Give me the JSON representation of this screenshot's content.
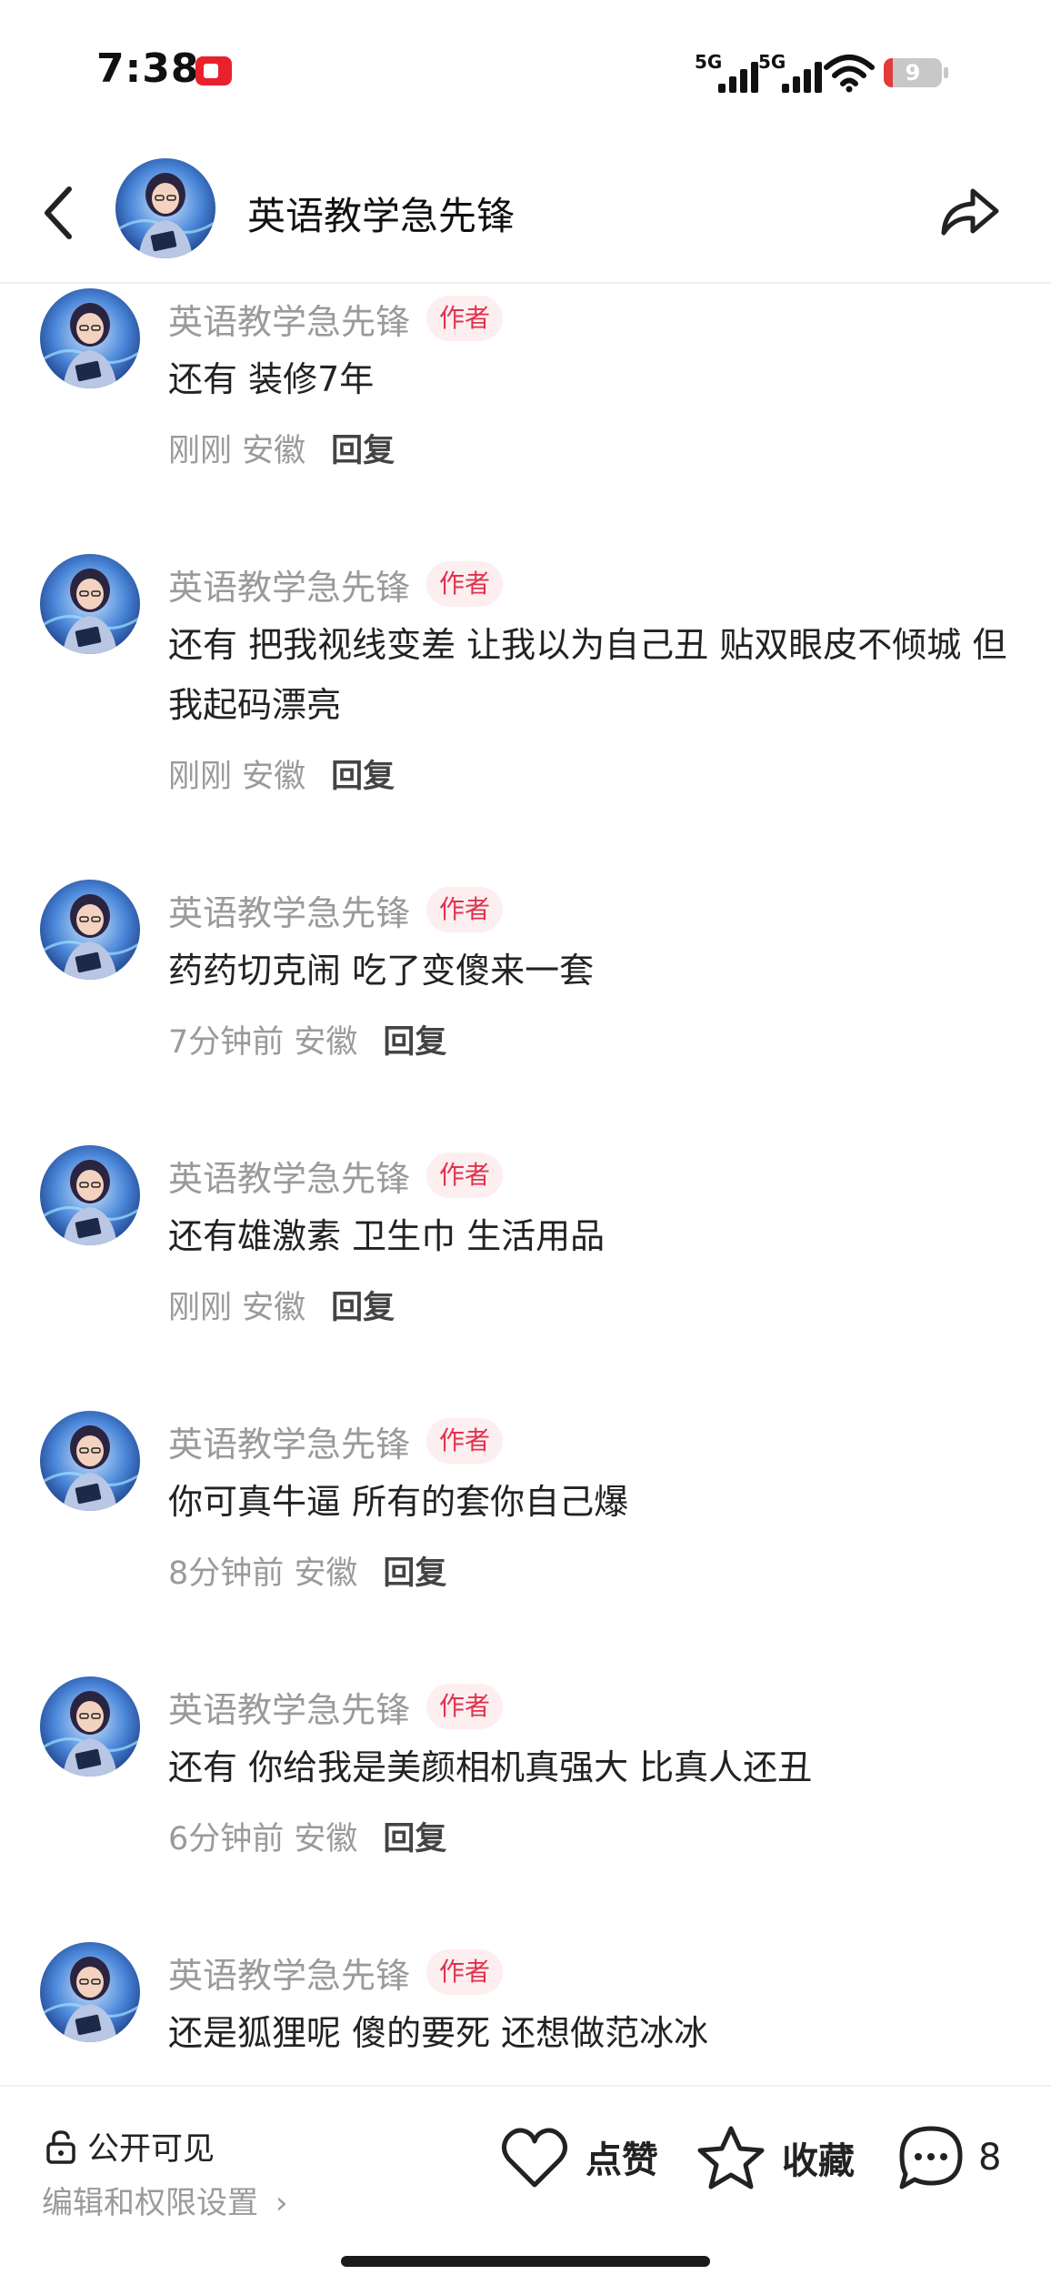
{
  "status_bar": {
    "time": "7:38",
    "net1": "5G",
    "net2": "5G",
    "battery_level": "9",
    "battery_fraction": 0.09
  },
  "header": {
    "title": "英语教学急先锋"
  },
  "comments": [
    {
      "name": "英语教学急先锋",
      "badge": "作者",
      "text": "还有 装修7年",
      "time": "刚刚 安徽",
      "reply": "回复"
    },
    {
      "name": "英语教学急先锋",
      "badge": "作者",
      "text": "还有 把我视线变差 让我以为自己丑 贴双眼皮不倾城 但我起码漂亮",
      "time": "刚刚 安徽",
      "reply": "回复"
    },
    {
      "name": "英语教学急先锋",
      "badge": "作者",
      "text": "药药切克闹 吃了变傻来一套",
      "time": "7分钟前 安徽",
      "reply": "回复"
    },
    {
      "name": "英语教学急先锋",
      "badge": "作者",
      "text": "还有雄激素 卫生巾 生活用品",
      "time": "刚刚 安徽",
      "reply": "回复"
    },
    {
      "name": "英语教学急先锋",
      "badge": "作者",
      "text": "你可真牛逼 所有的套你自己爆",
      "time": "8分钟前 安徽",
      "reply": "回复"
    },
    {
      "name": "英语教学急先锋",
      "badge": "作者",
      "text": "还有 你给我是美颜相机真强大 比真人还丑",
      "time": "6分钟前 安徽",
      "reply": "回复"
    },
    {
      "name": "英语教学急先锋",
      "badge": "作者",
      "text": "还是狐狸呢 傻的要死 还想做范冰冰",
      "time": "",
      "reply": ""
    }
  ],
  "bottom": {
    "visibility": "公开可见",
    "permissions": "编辑和权限设置",
    "like_label": "点赞",
    "collect_label": "收藏",
    "comment_count": "8"
  }
}
